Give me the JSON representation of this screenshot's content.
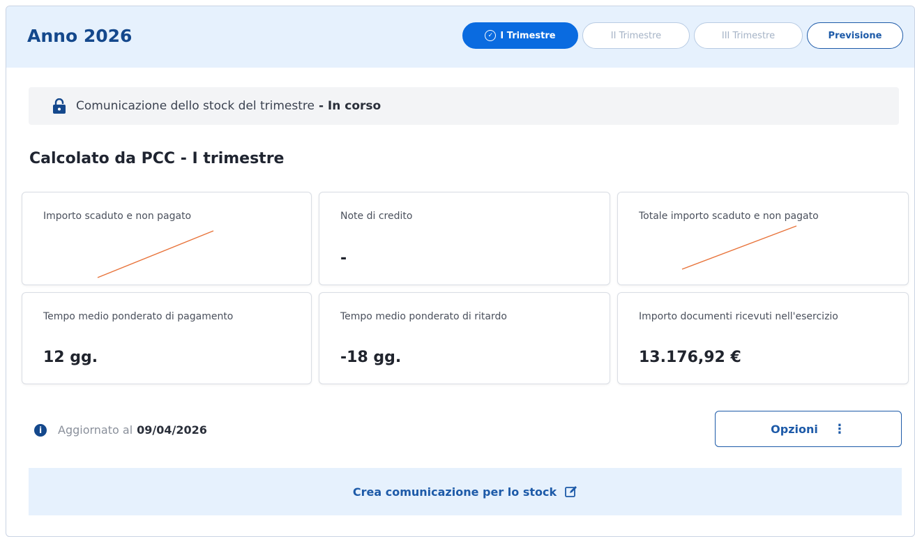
{
  "header": {
    "title": "Anno 2026",
    "tabs": [
      {
        "label": "I Trimestre",
        "state": "active"
      },
      {
        "label": "II Trimestre",
        "state": "disabled"
      },
      {
        "label": "III Trimestre",
        "state": "disabled"
      },
      {
        "label": "Previsione",
        "state": "normal"
      }
    ]
  },
  "status": {
    "icon": "lock-icon",
    "text": "Comunicazione dello stock del trimestre",
    "state": "- In corso"
  },
  "section": {
    "title": "Calcolato da PCC - I trimestre"
  },
  "metrics": [
    {
      "label": "Importo scaduto e non pagato",
      "value": "",
      "struck": true
    },
    {
      "label": "Note di credito",
      "value": "-",
      "struck": false
    },
    {
      "label": "Totale importo scaduto e non pagato",
      "value": "",
      "struck": true
    },
    {
      "label": "Tempo medio ponderato di pagamento",
      "value": "12 gg."
    },
    {
      "label": "Tempo medio ponderato di ritardo",
      "value": "-18 gg."
    },
    {
      "label": "Importo documenti ricevuti nell'esercizio",
      "value": "13.176,92 €"
    }
  ],
  "footer": {
    "updated_label": "Aggiornato al",
    "updated_date": "09/04/2026",
    "options_label": "Opzioni",
    "options_icon": "more-vertical-icon",
    "create_label": "Crea comunicazione per lo stock",
    "create_icon": "edit-icon"
  },
  "colors": {
    "accent": "#0a6be0",
    "brand_dark": "#14488c",
    "header_bg": "#e6f1fd",
    "strike_line": "#e8733a"
  }
}
